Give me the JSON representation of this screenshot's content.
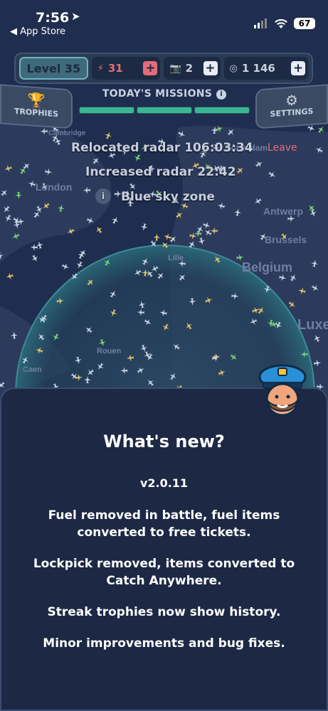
{
  "status_bar": {
    "time": "7:56",
    "back_label": "◀ App Store",
    "battery": "67"
  },
  "top_bar": {
    "level": "Level 35",
    "energy": "31",
    "camera": "2",
    "coins": "1 146"
  },
  "missions": {
    "title": "TODAY'S MISSIONS"
  },
  "nav": {
    "trophies": "TROPHIES",
    "settings": "SETTINGS"
  },
  "events": {
    "relocated": "Relocated radar 106:03:34",
    "leave": "Leave",
    "increased": "Increased radar 22:42",
    "blue_sky": "Blue sky zone"
  },
  "map_labels": [
    "Cambridge",
    "London",
    "Rotterdam",
    "Antwerp",
    "Brussels",
    "Belgium",
    "Lille",
    "Luxe",
    "Rouen",
    "Caen"
  ],
  "whats_new": {
    "title": "What's new?",
    "version": "v2.0.11",
    "notes": [
      "Fuel removed in battle, fuel items converted to free tickets.",
      "Lockpick removed, items converted to Catch Anywhere.",
      "Streak trophies now show history.",
      "Minor improvements and bug fixes."
    ]
  },
  "colors": {
    "panel_bg": "#1c2844",
    "map_bg": "#1f2d4e",
    "accent_green": "#3bb594",
    "leave_red": "#e46b7a"
  }
}
